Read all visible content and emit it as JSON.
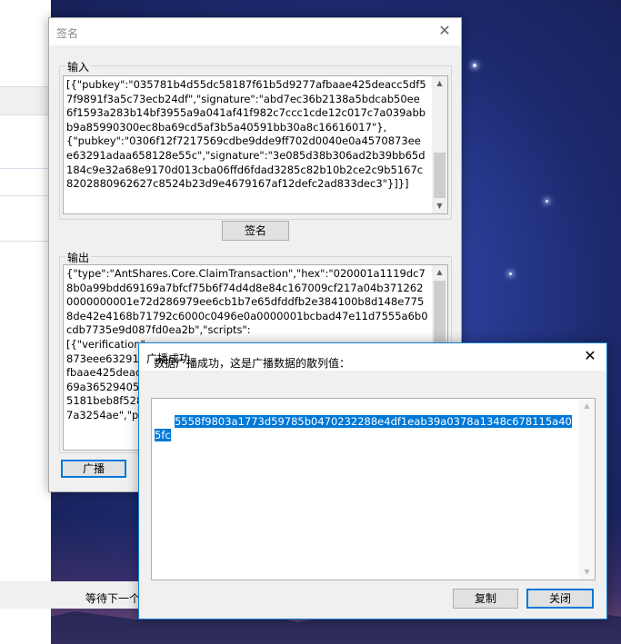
{
  "background_window": {
    "status_text": "等待下一个"
  },
  "sign_dialog": {
    "title": "签名",
    "input_group_label": "输入",
    "input_text": "[{\"pubkey\":\"035781b4d55dc58187f61b5d9277afbaae425deacc5df57f9891f3a5c73ecb24df\",\"signature\":\"abd7ec36b2138a5bdcab50ee6f1593a283b14bf3955a9a041af41f982c7ccc1cde12c017c7a039abbb9a85990300ec8ba69cd5af3b5a40591bb30a8c16616017\"},\n{\"pubkey\":\"0306f12f7217569cdbe9dde9ff702d0040e0a4570873eee63291adaa658128e55c\",\"signature\":\"3e085d38b306ad2b39bb65d184c9e32a68e9170d013cba06ffd6fdad3285c82b10b2ce2c9b5167c8202880962627c8524b23d9e4679167af12defc2ad833dec3\"}]}]",
    "sign_button": "签名",
    "output_group_label": "输出",
    "output_text": "{\"type\":\"AntShares.Core.ClaimTransaction\",\"hex\":\"020001a1119dc78b0a99bdd69169a7bfcf75b6f74d4d8e84c167009cf217a04b3712620000000001e72d286979ee6cb1b7e65dfddfb2e384100b8d148e7758de42e4168b71792c6000c0496e0a0000001bcbad47e11d7555a6b0cdb7735e9d087fd0ea2b\",\"scripts\":\n[{\"verification\"\n873eee63291a\nfbaae425deac\n69a36529405\n5181beb8f528\n7a3254ae\",\"pa",
    "broadcast_button": "广播"
  },
  "broadcast_dialog": {
    "title": "广播成功",
    "message": "数据广播成功，这是广播数据的散列值：",
    "hash": "5558f9803a1773d59785b0470232288e4df1eab39a0378a1348c678115a405fc",
    "copy_button": "复制",
    "close_button": "关闭"
  },
  "icons": {
    "close": "close-icon",
    "scroll_up": "scroll-up-arrow-icon",
    "scroll_down": "scroll-down-arrow-icon"
  },
  "colors": {
    "accent": "#0078d7",
    "selection_bg": "#0078d7",
    "dialog_bg": "#f0f0f0"
  }
}
